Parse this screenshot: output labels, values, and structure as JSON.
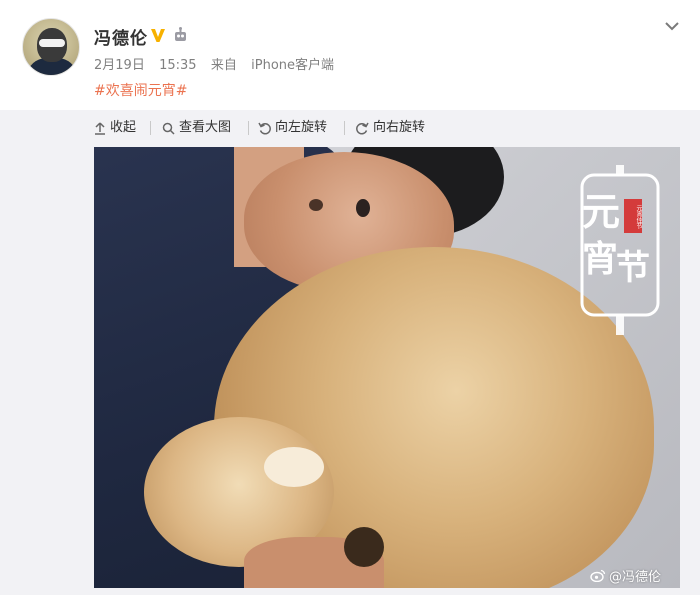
{
  "post": {
    "username": "冯德伦",
    "verified_icon": "verified-v-icon",
    "member_icon": "weibo-member-icon",
    "menu_icon": "chevron-down-icon",
    "meta": {
      "date": "2月19日",
      "time": "15:35",
      "source_prefix": "来自",
      "source": "iPhone客户端"
    },
    "text": "#欢喜闹元宵#"
  },
  "toolbar": {
    "items": [
      {
        "label": "收起",
        "icon": "collapse-up-icon"
      },
      {
        "label": "查看大图",
        "icon": "magnify-icon"
      },
      {
        "label": "向左旋转",
        "icon": "rotate-left-icon"
      },
      {
        "label": "向右旋转",
        "icon": "rotate-right-icon"
      }
    ]
  },
  "image": {
    "overlay": {
      "char1": "元",
      "char2": "宵",
      "char3": "节",
      "seal": "元宵佳节"
    },
    "watermark": "@冯德伦"
  },
  "colors": {
    "accent_link": "#eb7350",
    "verified": "#f7b100",
    "meta_gray": "#808080",
    "panel_bg": "#f2f2f5"
  }
}
